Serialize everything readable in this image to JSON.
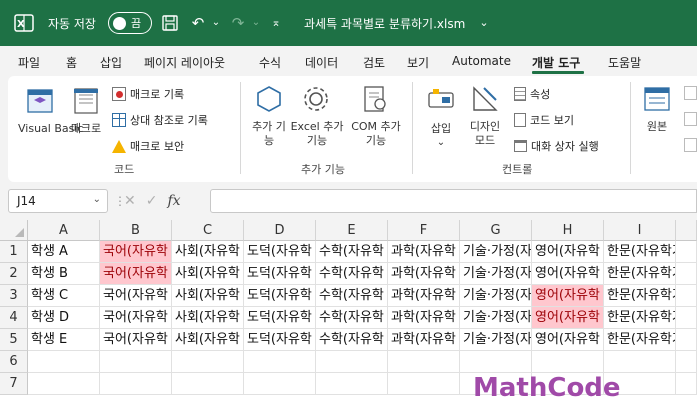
{
  "titlebar": {
    "autosave_label": "자동 저장",
    "toggle_text": "끔",
    "doc_title": "과세특 과목별로 분류하기.xlsm",
    "bg_color": "#1e7145"
  },
  "tabs": [
    "파일",
    "홈",
    "삽입",
    "페이지 레이아웃",
    "수식",
    "데이터",
    "검토",
    "보기",
    "Automate",
    "개발 도구",
    "도움말"
  ],
  "active_tab": "개발 도구",
  "ribbon": {
    "code": {
      "visual_basic": "Visual Basic",
      "macro": "매크로",
      "record_macro": "매크로 기록",
      "relative_ref": "상대 참조로 기록",
      "macro_security": "매크로 보안",
      "group_label": "코드"
    },
    "addins": {
      "addins": "추가 기능",
      "excel_addins": "Excel 추가 기능",
      "com_addins": "COM 추가 기능",
      "group_label": "추가 기능"
    },
    "controls": {
      "insert": "삽입",
      "design_mode": "디자인 모드",
      "properties": "속성",
      "view_code": "코드 보기",
      "run_dialog": "대화 상자 실행",
      "group_label": "컨트롤"
    },
    "xml": {
      "source": "원본"
    }
  },
  "formula_bar": {
    "name_box": "J14",
    "fx": "fx",
    "formula": ""
  },
  "grid": {
    "columns": [
      "A",
      "B",
      "C",
      "D",
      "E",
      "F",
      "G",
      "H",
      "I"
    ],
    "rows": [
      "1",
      "2",
      "3",
      "4",
      "5",
      "6",
      "7"
    ],
    "cells": [
      [
        "학생 A",
        "국어(자유학",
        "사회(자유학",
        "도덕(자유학",
        "수학(자유학",
        "과학(자유학",
        "기술·가정(자",
        "영어(자유학",
        "한문(자유학기"
      ],
      [
        "학생 B",
        "국어(자유학",
        "사회(자유학",
        "도덕(자유학",
        "수학(자유학",
        "과학(자유학",
        "기술·가정(자",
        "영어(자유학",
        "한문(자유학기"
      ],
      [
        "학생 C",
        "국어(자유학",
        "사회(자유학",
        "도덕(자유학",
        "수학(자유학",
        "과학(자유학",
        "기술·가정(자",
        "영어(자유학",
        "한문(자유학기"
      ],
      [
        "학생 D",
        "국어(자유학",
        "사회(자유학",
        "도덕(자유학",
        "수학(자유학",
        "과학(자유학",
        "기술·가정(자",
        "영어(자유학",
        "한문(자유학기"
      ],
      [
        "학생 E",
        "국어(자유학",
        "사회(자유학",
        "도덕(자유학",
        "수학(자유학",
        "과학(자유학",
        "기술·가정(자",
        "영어(자유학",
        "한문(자유학기"
      ],
      [
        "",
        "",
        "",
        "",
        "",
        "",
        "",
        "",
        ""
      ],
      [
        "",
        "",
        "",
        "",
        "",
        "",
        "",
        "",
        ""
      ]
    ],
    "highlight_color": "#ffc7ce",
    "highlight_text_color": "#9c0006"
  },
  "watermark": "MathCode"
}
